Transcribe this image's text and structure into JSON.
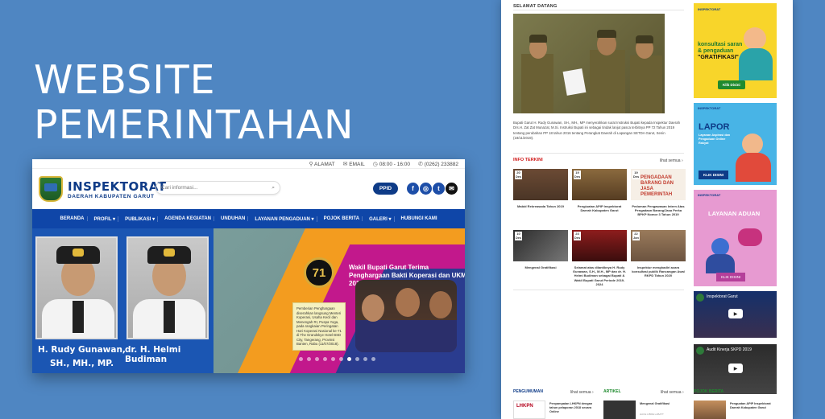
{
  "headline": {
    "line1": "WEBSITE",
    "line2": "PEMERINTAHAN"
  },
  "site": {
    "topbar": {
      "alamat": "ALAMAT",
      "email": "EMAIL",
      "hours": "08:00 - 16:00",
      "phone": "(0262) 233882"
    },
    "brand": {
      "title": "INSPEKTORAT",
      "subtitle": "DAERAH KABUPATEN GARUT"
    },
    "search": {
      "placeholder": "Cari informasi..."
    },
    "ppid_label": "PPID",
    "nav": [
      "BERANDA",
      "PROFIL ▾",
      "PUBLIKASI ▾",
      "AGENDA KEGIATAN",
      "UNDUHAN",
      "LAYANAN PENGADUAN ▾",
      "POJOK BERITA",
      "GALERI ▾",
      "HUBUNGI KAMI"
    ],
    "hero": {
      "name1a": "H. Rudy Gunawan,",
      "name1b": "SH., MH., MP.",
      "name2": "dr. H. Helmi Budiman",
      "slide_title": "Wakil Bupati Garut Terima Penghargaan Bakti Koperasi dan UKM 2018",
      "slide_logo": "71",
      "slide_note": "Pemberian Penghargaan diserahkan langsung Menteri Koperasi, Usaha Kecil dan Menengah RI, Puspa Yoga, pada rangkaian Peringatan Hari Koperasi Nasional ke-71 di The Grandskye Hotel BSD City, Tangerang, Provinsi Banten, Rabu (11/07/2018)."
    }
  },
  "page": {
    "welcome_title": "SELAMAT DATANG",
    "welcome_text": "Bupati Garut H. Rudy Gunawan, SH., MH., MP menyerahkan surat Instruksi Bupati kepada Inspektur Daerah Drs.H. Zat Zat Munazat, M.Si. Instruksi Bupati ini sebagai tindak lanjut pasca terbitnya PP 72 Tahun 2019 tentang perubahan PP 18 tahun 2016 tentang Perangkat Daerah di Lapangan SETDA Garut, Senin (18/11/2019).",
    "info_title": "INFO TERKINI",
    "lihat_semua": "lihat semua ›",
    "info_tiles": [
      {
        "date": "20 Des",
        "caption": "Mabid Rekreasada Tahun 2019"
      },
      {
        "date": "19 Des",
        "caption": "Pengiuatan APIP Inspektorat Daerah Kabupaten Garut"
      },
      {
        "date": "19 Des",
        "caption": "Pedoman Pengawasan Intern Atas Pengadaan Barang/Jasa Perka BPKP Nomor 3 Tahun 2019"
      },
      {
        "date": "10 Des",
        "caption": "Mengenal Gratifikasi"
      },
      {
        "date": "23 Des",
        "caption": "Selamat atas dilantiknya H. Rudy Gunawan, S.H., M.H., MP dan dr. H. Helmi Budiman sebagai Bupati & Wakil Bupati Garut Periode 2019-2024"
      },
      {
        "date": "22 Jan",
        "caption": "Inspektur menghadiri acara konsultasi publik Rancangan Awal RKPD Tahun 2020"
      }
    ],
    "tile3_banner": "PENGADAAN BARANG DAN JASA PEMERINTAH",
    "pengumuman_title": "PENGUMUMAN",
    "artikel_title": "ARTIKEL",
    "pengumuman_item": "Penyampaian LHKPN dengan tahun pelaporan 2018 secara Online",
    "artikel_item": "Mengenal Gratifikasi",
    "artikel_meta": "HACE LIBRE LABATT",
    "pojok_item": "Penguatan APIP Inspektorat Daerah Kabupaten Garut",
    "ads": {
      "a1_brand": "INSPEKTORAT",
      "a1_line1": "konsultasi saran",
      "a1_line2": "& pengaduan",
      "a1_line3": "\"GRATIFIKASI\"",
      "a1_btn": "Klik Disini",
      "a2_brand": "INSPEKTORAT",
      "a2_title": "LAPOR",
      "a2_sub": "Layanan Aspirasi dan Pengaduan Online Rakyat",
      "a2_btn": "KLIK DISINI",
      "a3_brand": "INSPEKTORAT",
      "a3_title": "LAYANAN ADUAN",
      "a3_btn": "KLIK DISINI"
    },
    "video1_title": "Inspektorat Garut",
    "video2_title": "Audit Kinerja SKPD 2019",
    "pojok_label": "POJOK BERITA"
  }
}
